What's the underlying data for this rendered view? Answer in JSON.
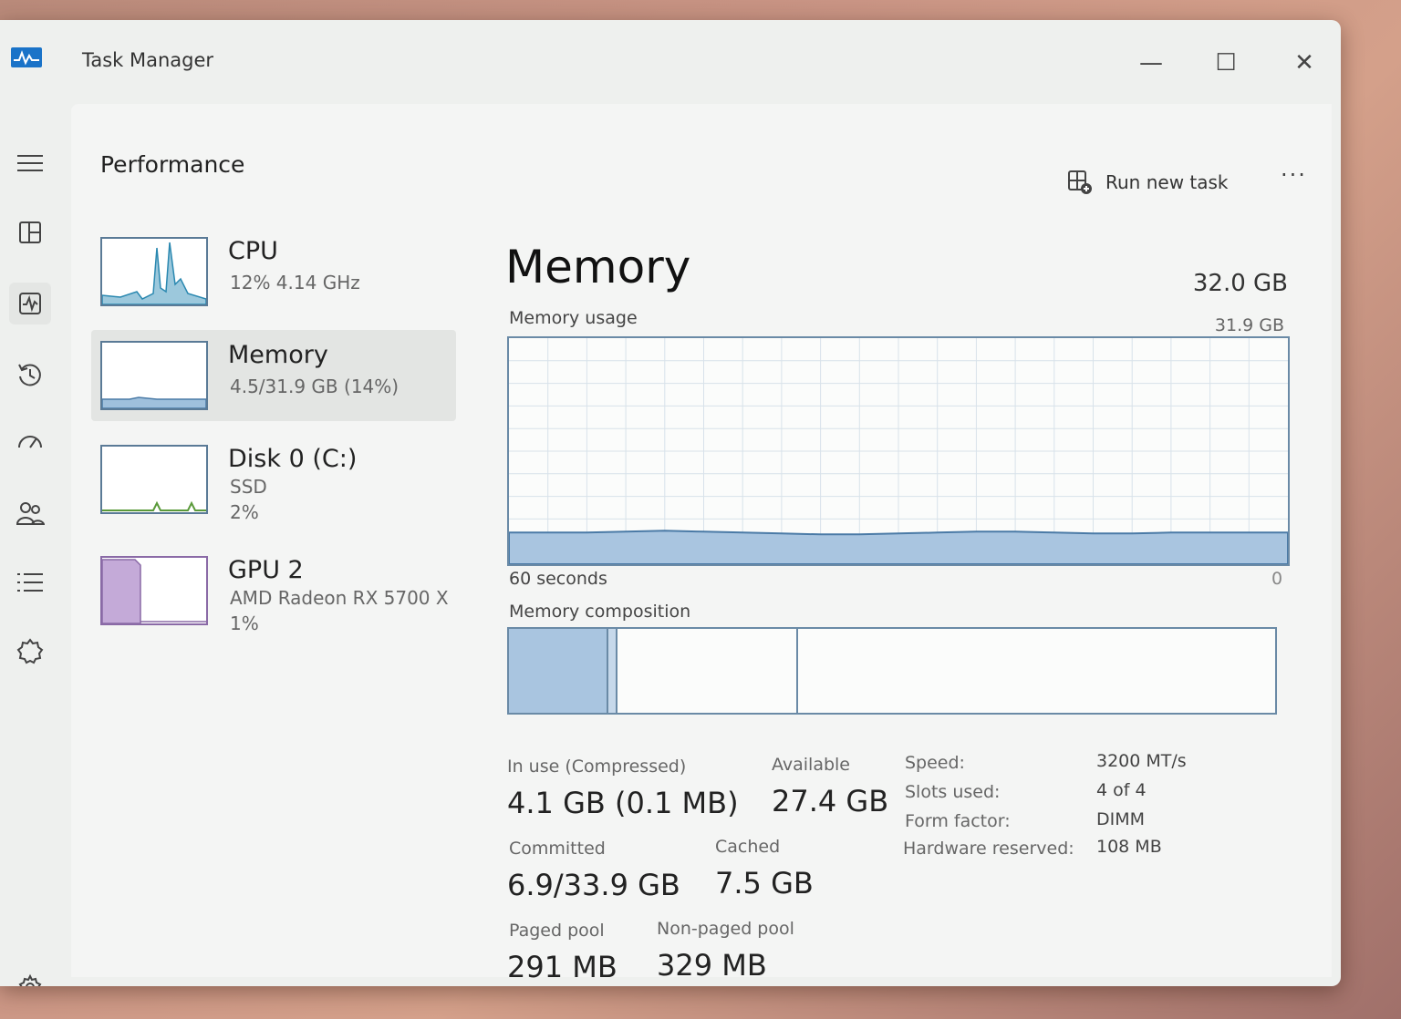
{
  "window": {
    "title": "Task Manager",
    "accent": "#1a73c8"
  },
  "controls": {
    "minimize": "—",
    "maximize": "☐",
    "close": "✕"
  },
  "nav": [
    {
      "name": "hamburger-icon"
    },
    {
      "name": "processes-icon"
    },
    {
      "name": "performance-icon"
    },
    {
      "name": "app-history-icon"
    },
    {
      "name": "startup-apps-icon"
    },
    {
      "name": "users-icon"
    },
    {
      "name": "details-icon"
    },
    {
      "name": "services-icon"
    },
    {
      "name": "settings-icon"
    }
  ],
  "page": {
    "title": "Performance",
    "run_new_task": "Run new task",
    "more": "···"
  },
  "sidebar": [
    {
      "name": "CPU",
      "sub1": "12% 4.14 GHz"
    },
    {
      "name": "Memory",
      "sub1": "4.5/31.9 GB (14%)"
    },
    {
      "name": "Disk 0 (C:)",
      "sub1": "SSD",
      "sub2": "2%"
    },
    {
      "name": "GPU 2",
      "sub1": "AMD Radeon RX 5700 X",
      "sub2": "1%"
    }
  ],
  "memory": {
    "heading": "Memory",
    "total": "32.0 GB",
    "usage_label": "Memory usage",
    "usage_max": "31.9 GB",
    "time_span": "60 seconds",
    "usage_min": "0",
    "composition_label": "Memory composition",
    "composition": {
      "in_use_fraction": 0.13,
      "modified_fraction": 0.012,
      "standby_fraction": 0.235
    },
    "usage_fraction": 0.14,
    "stats": {
      "in_use_label": "In use (Compressed)",
      "in_use": "4.1 GB (0.1 MB)",
      "available_label": "Available",
      "available": "27.4 GB",
      "committed_label": "Committed",
      "committed": "6.9/33.9 GB",
      "cached_label": "Cached",
      "cached": "7.5 GB",
      "paged_label": "Paged pool",
      "paged": "291 MB",
      "nonpaged_label": "Non-paged pool",
      "nonpaged": "329 MB"
    },
    "specs": {
      "speed_label": "Speed:",
      "speed": "3200 MT/s",
      "slots_label": "Slots used:",
      "slots": "4 of 4",
      "form_label": "Form factor:",
      "form": "DIMM",
      "hw_label": "Hardware reserved:",
      "hw": "108 MB"
    }
  }
}
